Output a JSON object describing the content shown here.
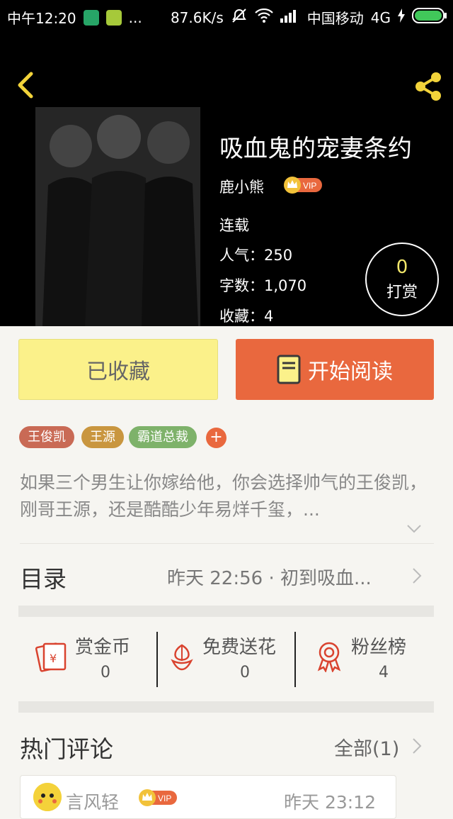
{
  "status_bar": {
    "time": "中午12:20",
    "dots": "...",
    "speed": "87.6K/s",
    "carrier": "中国移动",
    "network": "4G"
  },
  "book": {
    "title": "吸血鬼的宠妻条约",
    "author": "鹿小熊",
    "vip_badge": "VIP",
    "status": "连载",
    "popularity": "人气：250",
    "words": "字数：1,070",
    "favorites": "收藏：4"
  },
  "tip": {
    "count": "0",
    "label": "打赏"
  },
  "actions": {
    "fav_label": "已收藏",
    "read_label": "开始阅读"
  },
  "tags": [
    {
      "label": "王俊凯",
      "color": "#c96a55"
    },
    {
      "label": "王源",
      "color": "#c9963f"
    },
    {
      "label": "霸道总裁",
      "color": "#7eb26a"
    }
  ],
  "tag_add": "+",
  "description": "如果三个男生让你嫁给他，你会选择帅气的王俊凯，刚哥王源，还是酷酷少年易烊千玺，...",
  "toc": {
    "label": "目录",
    "latest": "昨天 22:56 · 初到吸血..."
  },
  "stats": [
    {
      "label": "赏金币",
      "value": "0",
      "icon": "red-envelope-icon"
    },
    {
      "label": "免费送花",
      "value": "0",
      "icon": "flower-icon"
    },
    {
      "label": "粉丝榜",
      "value": "4",
      "icon": "ribbon-medal-icon"
    }
  ],
  "comments": {
    "title": "热门评论",
    "all_label": "全部(1)",
    "items": [
      {
        "user": "言风轻",
        "vip": "VIP",
        "time": "昨天 23:12"
      }
    ]
  },
  "colors": {
    "accent": "#e9683e",
    "gold": "#f2d33a",
    "fav_bg": "#fbf18a"
  }
}
